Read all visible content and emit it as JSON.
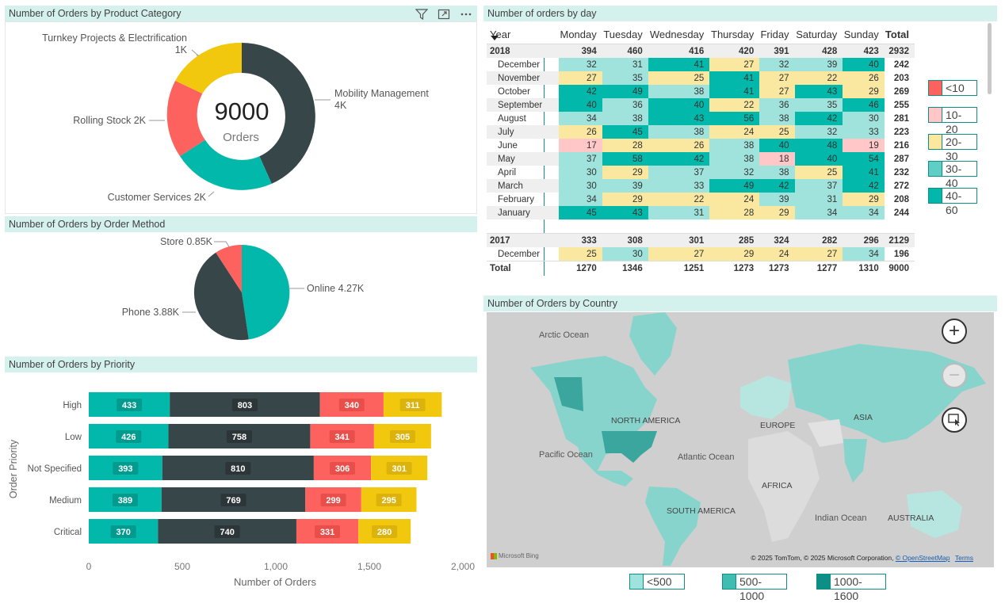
{
  "product_category": {
    "title": "Number of Orders by Product Category",
    "center_value": "9000",
    "center_label": "Orders",
    "labels": {
      "mobility": "Mobility Management",
      "mobility_val": "4K",
      "turnkey": "Turnkey Projects & Electrification",
      "turnkey_val": "1K",
      "rolling": "Rolling Stock 2K",
      "customer": "Customer Services 2K"
    },
    "colors": {
      "mobility": "#374649",
      "customer": "#01b8aa",
      "rolling": "#fd625e",
      "turnkey": "#f2c80f"
    }
  },
  "order_method": {
    "title": "Number of Orders by Order Method",
    "labels": {
      "store": "Store 0.85K",
      "online": "Online 4.27K",
      "phone": "Phone 3.88K"
    }
  },
  "priority": {
    "title": "Number of Orders by Priority",
    "ylabel": "Order Priority",
    "xlabel": "Number of Orders",
    "ticks": [
      "0",
      "500",
      "1,000",
      "1,500",
      "2,000"
    ]
  },
  "orders_by_day": {
    "title": "Number of orders by day",
    "header": [
      "Year",
      "Monday",
      "Tuesday",
      "Wednesday",
      "Thursday",
      "Friday",
      "Saturday",
      "Sunday",
      "Total"
    ],
    "rows": [
      {
        "label": "2018",
        "type": "year",
        "vals": [
          "394",
          "460",
          "416",
          "420",
          "391",
          "428",
          "423",
          "2932"
        ]
      },
      {
        "label": "December",
        "type": "m",
        "vals": [
          "32",
          "31",
          "41",
          "27",
          "32",
          "39",
          "40",
          "242"
        ]
      },
      {
        "label": "November",
        "type": "m",
        "vals": [
          "27",
          "35",
          "25",
          "41",
          "27",
          "22",
          "26",
          "203"
        ]
      },
      {
        "label": "October",
        "type": "m",
        "vals": [
          "42",
          "49",
          "38",
          "41",
          "27",
          "43",
          "29",
          "269"
        ]
      },
      {
        "label": "September",
        "type": "m",
        "vals": [
          "40",
          "36",
          "40",
          "22",
          "36",
          "35",
          "46",
          "255"
        ]
      },
      {
        "label": "August",
        "type": "m",
        "vals": [
          "34",
          "38",
          "43",
          "56",
          "38",
          "42",
          "30",
          "281"
        ]
      },
      {
        "label": "July",
        "type": "m",
        "vals": [
          "26",
          "45",
          "38",
          "24",
          "25",
          "32",
          "33",
          "223"
        ]
      },
      {
        "label": "June",
        "type": "m",
        "vals": [
          "17",
          "28",
          "26",
          "38",
          "40",
          "48",
          "19",
          "216"
        ]
      },
      {
        "label": "May",
        "type": "m",
        "vals": [
          "37",
          "58",
          "42",
          "38",
          "18",
          "40",
          "54",
          "287"
        ]
      },
      {
        "label": "April",
        "type": "m",
        "vals": [
          "30",
          "29",
          "37",
          "32",
          "38",
          "25",
          "41",
          "232"
        ]
      },
      {
        "label": "March",
        "type": "m",
        "vals": [
          "30",
          "39",
          "33",
          "49",
          "42",
          "37",
          "42",
          "272"
        ]
      },
      {
        "label": "February",
        "type": "m",
        "vals": [
          "34",
          "29",
          "22",
          "24",
          "39",
          "31",
          "29",
          "208"
        ]
      },
      {
        "label": "January",
        "type": "m",
        "vals": [
          "45",
          "43",
          "31",
          "28",
          "29",
          "34",
          "34",
          "244"
        ]
      },
      {
        "label": "",
        "type": "blank",
        "vals": [
          "",
          "",
          "",
          "",
          "",
          "",
          "",
          ""
        ]
      },
      {
        "label": "2017",
        "type": "year",
        "vals": [
          "333",
          "308",
          "301",
          "285",
          "324",
          "282",
          "296",
          "2129"
        ]
      },
      {
        "label": "December",
        "type": "m",
        "vals": [
          "25",
          "30",
          "27",
          "29",
          "24",
          "27",
          "34",
          "196"
        ]
      },
      {
        "label": "Total",
        "type": "total",
        "vals": [
          "1270",
          "1346",
          "1251",
          "1273",
          "1273",
          "1277",
          "1310",
          "9000"
        ]
      }
    ],
    "legend": [
      "<10",
      "10-20",
      "20-30",
      "30-40",
      "40-60"
    ]
  },
  "country": {
    "title": "Number of Orders by Country",
    "places": {
      "arctic": "Arctic Ocean",
      "na": "NORTH AMERICA",
      "pacific": "Pacific Ocean",
      "atlantic": "Atlantic Ocean",
      "europe": "EUROPE",
      "asia": "ASIA",
      "africa": "AFRICA",
      "sa": "SOUTH AMERICA",
      "indian": "Indian Ocean",
      "australia": "AUSTRALIA"
    },
    "attribution": "© 2025 TomTom, © 2025 Microsoft Corporation,",
    "osm": "© OpenStreetMap",
    "terms": "Terms",
    "bing": "Microsoft Bing",
    "legend": [
      "<500",
      "500-1000",
      "1000-1600"
    ]
  },
  "chart_data": [
    {
      "type": "pie",
      "title": "Number of Orders by Product Category",
      "center": "9000 Orders",
      "categories": [
        "Mobility Management",
        "Customer Services",
        "Rolling Stock",
        "Turnkey Projects & Electrification"
      ],
      "values": [
        4000,
        2000,
        2000,
        1000
      ]
    },
    {
      "type": "pie",
      "title": "Number of Orders by Order Method",
      "categories": [
        "Online",
        "Phone",
        "Store"
      ],
      "values": [
        4.27,
        3.88,
        0.85
      ],
      "unit": "K"
    },
    {
      "type": "bar",
      "title": "Number of Orders by Priority",
      "orientation": "horizontal",
      "stacked": true,
      "categories": [
        "High",
        "Low",
        "Not Specified",
        "Medium",
        "Critical"
      ],
      "series": [
        {
          "values": [
            433,
            426,
            393,
            389,
            370
          ],
          "color": "#01b8aa"
        },
        {
          "values": [
            803,
            758,
            810,
            769,
            740
          ],
          "color": "#374649"
        },
        {
          "values": [
            340,
            341,
            306,
            299,
            331
          ],
          "color": "#fd625e"
        },
        {
          "values": [
            311,
            305,
            301,
            295,
            280
          ],
          "color": "#f2c80f"
        }
      ],
      "xlabel": "Number of Orders",
      "ylabel": "Order Priority",
      "xlim": [
        0,
        2000
      ]
    }
  ]
}
